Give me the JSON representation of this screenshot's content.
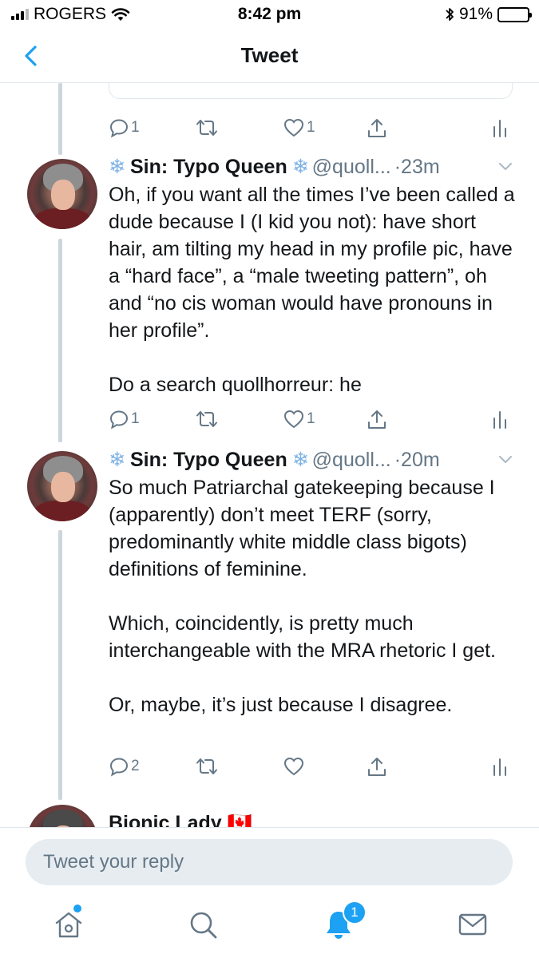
{
  "status_bar": {
    "carrier": "ROGERS",
    "time": "8:42 pm",
    "battery": "91%",
    "battery_level": 0.91
  },
  "nav": {
    "title": "Tweet"
  },
  "top_actions": {
    "reply_count": "1",
    "like_count": "1"
  },
  "tweets": [
    {
      "name": "Sin: Typo Queen",
      "handle": "@quoll...",
      "time": "·23m",
      "body": "Oh, if you want all the times I’ve been called a dude because I (I kid you not): have short hair, am tilting my head in my profile pic, have a “hard face”, a “male tweeting pattern”, oh and “no cis woman would have pronouns in her profile”.\n\nDo a search quollhorreur: he",
      "reply_count": "1",
      "like_count": "1"
    },
    {
      "name": "Sin: Typo Queen",
      "handle": "@quoll...",
      "time": "·20m",
      "body": "So much Patriarchal gatekeeping because I (apparently) don’t meet TERF (sorry, predominantly white middle class bigots) definitions of feminine.\n\nWhich, coincidently, is pretty much interchangeable with the MRA rhetoric I get.\n\nOr, maybe, it’s just because I disagree.",
      "reply_count": "2",
      "like_count": ""
    }
  ],
  "partial_tweet": {
    "name": "Bionic Lady 🇨🇦"
  },
  "reply": {
    "placeholder": "Tweet your reply"
  },
  "tabbar": {
    "notifications_badge": "1"
  },
  "colors": {
    "accent": "#1da1f2",
    "muted": "#657786",
    "divider": "#e1e8ed",
    "thread": "#ccd6dd"
  }
}
